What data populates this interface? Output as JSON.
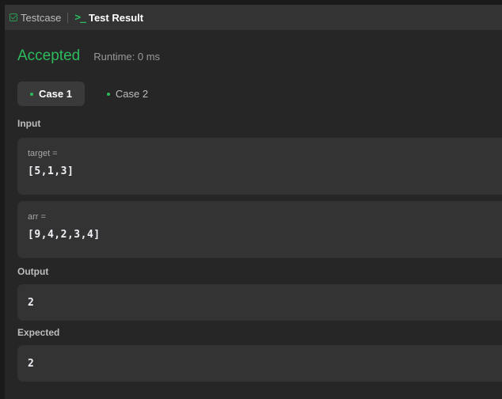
{
  "tabs": {
    "testcase_label": "Testcase",
    "test_result_label": "Test Result",
    "terminal_glyph": ">_"
  },
  "result": {
    "status": "Accepted",
    "runtime": "Runtime: 0 ms",
    "status_color": "#2cbb5d"
  },
  "cases": [
    {
      "label": "Case 1",
      "active": true
    },
    {
      "label": "Case 2",
      "active": false
    }
  ],
  "input": {
    "section_label": "Input",
    "params": [
      {
        "name": "target =",
        "value": "[5,1,3]"
      },
      {
        "name": "arr =",
        "value": "[9,4,2,3,4]"
      }
    ]
  },
  "output": {
    "section_label": "Output",
    "value": "2"
  },
  "expected": {
    "section_label": "Expected",
    "value": "2"
  }
}
